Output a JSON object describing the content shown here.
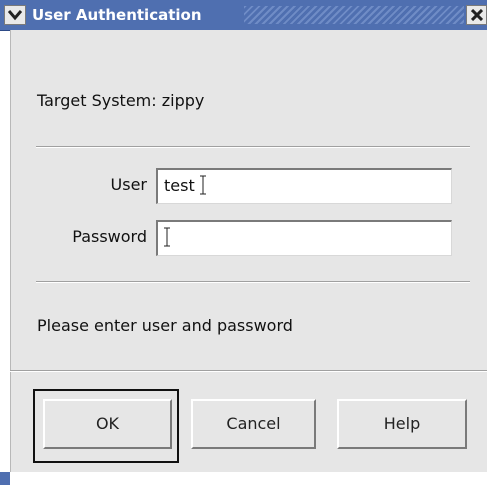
{
  "window": {
    "title": "User Authentication",
    "menu_icon": "chevron-down-icon",
    "close_icon": "close-icon"
  },
  "target": {
    "label": "Target System: zippy"
  },
  "form": {
    "user_label": "User",
    "user_value": "test",
    "password_label": "Password",
    "password_value": ""
  },
  "status": {
    "message": "Please enter user and password"
  },
  "buttons": {
    "ok": "OK",
    "cancel": "Cancel",
    "help": "Help"
  },
  "colors": {
    "titlebar": "#4f6fb0",
    "dialog_bg": "#e6e6e6"
  }
}
